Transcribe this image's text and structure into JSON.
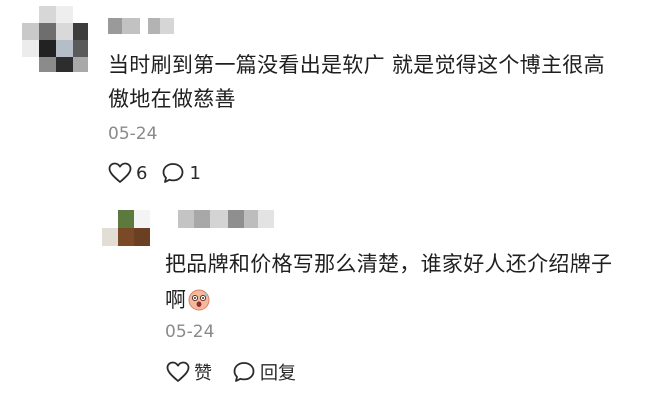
{
  "comment": {
    "username": "",
    "text_line1": "当时刷到第一篇没看出是软广 就是觉得这个博主很高",
    "text_line2": "傲地在做慈善",
    "date": "05-24",
    "like_icon": "heart-outline-icon",
    "like_count": "6",
    "reply_icon": "speech-bubble-icon",
    "reply_count": "1"
  },
  "reply": {
    "username": "",
    "text_line1": "把品牌和价格写那么清楚，谁家好人还介绍牌子",
    "text_line2": "啊",
    "emoji_icon": "shocked-face-emoji",
    "date": "05-24",
    "like_icon": "heart-outline-icon",
    "like_label": "赞",
    "reply_icon": "speech-bubble-icon",
    "reply_label": "回复"
  },
  "colors": {
    "text": "#1f1f1f",
    "muted": "#8a8a8a",
    "icon": "#2a2a2a"
  }
}
